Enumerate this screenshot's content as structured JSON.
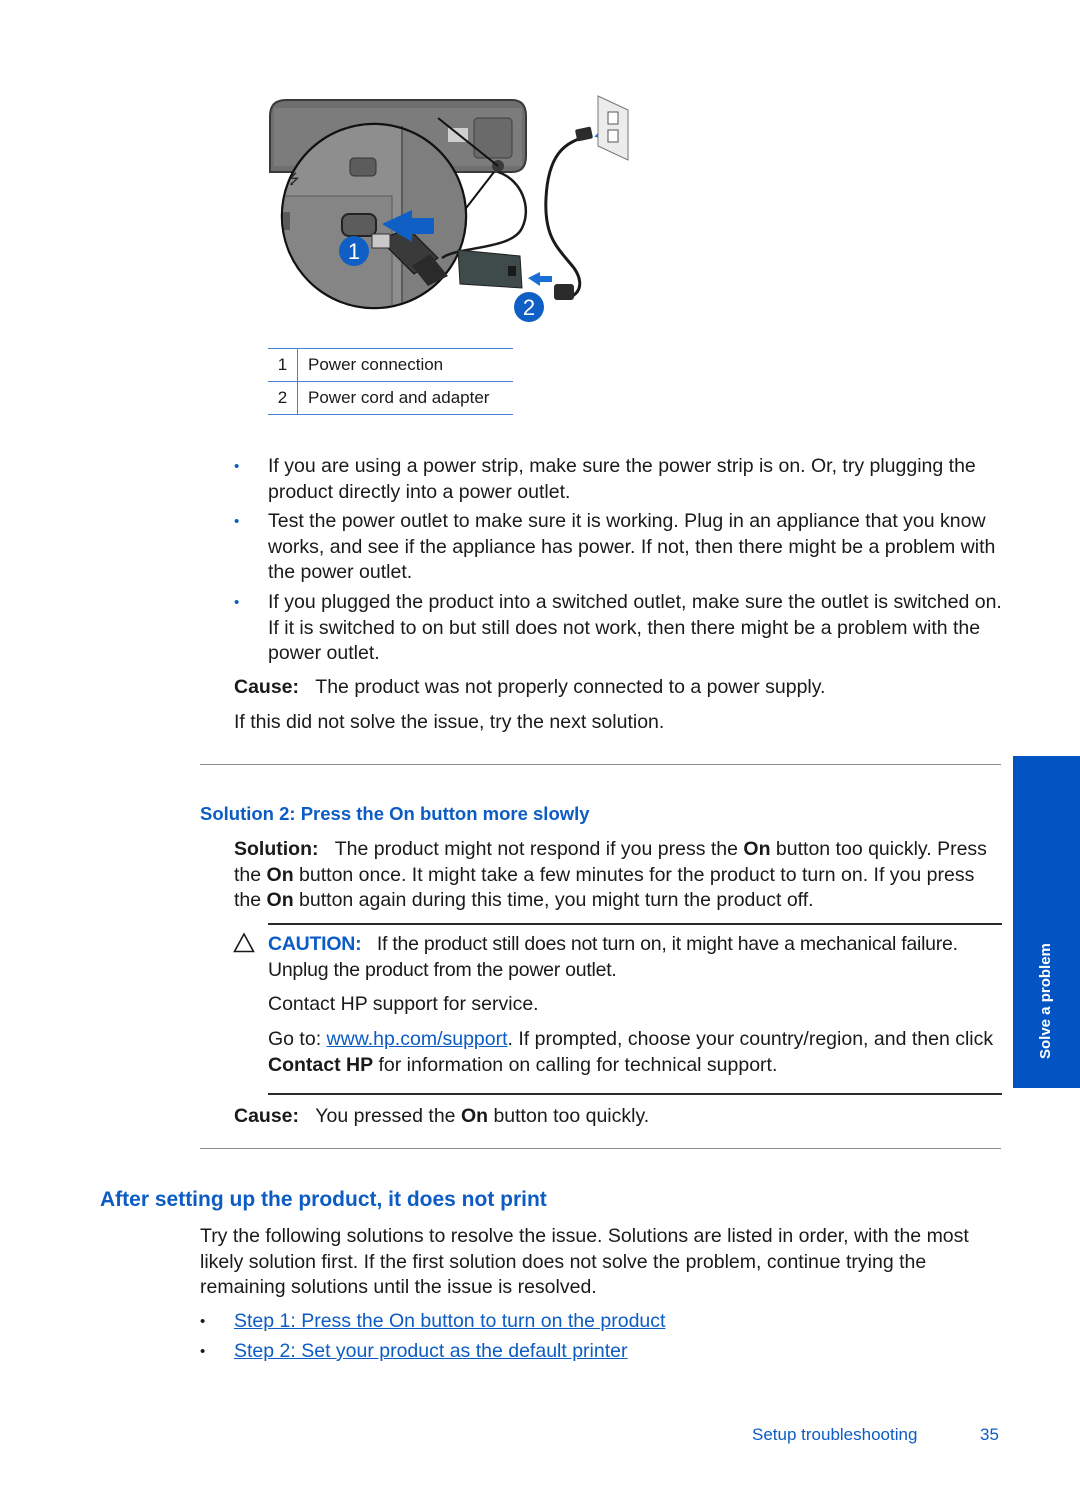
{
  "figure": {
    "callouts": [
      "1",
      "2"
    ],
    "legend": [
      {
        "num": "1",
        "label": "Power connection"
      },
      {
        "num": "2",
        "label": "Power cord and adapter"
      }
    ]
  },
  "solution1": {
    "bullets": [
      "If you are using a power strip, make sure the power strip is on. Or, try plugging the product directly into a power outlet.",
      "Test the power outlet to make sure it is working. Plug in an appliance that you know works, and see if the appliance has power. If not, then there might be a problem with the power outlet.",
      "If you plugged the product into a switched outlet, make sure the outlet is switched on. If it is switched to on but still does not work, then there might be a problem with the power outlet."
    ],
    "cause_label": "Cause:",
    "cause_text": "The product was not properly connected to a power supply.",
    "next_text": "If this did not solve the issue, try the next solution."
  },
  "solution2": {
    "heading": "Solution 2: Press the On button more slowly",
    "solution_label": "Solution:",
    "text_parts": [
      "The product might not respond if you press the ",
      "On",
      " button too quickly. Press the ",
      "On",
      " button once. It might take a few minutes for the product to turn on. If you press the ",
      "On",
      " button again during this time, you might turn the product off."
    ],
    "caution": {
      "label": "CAUTION:",
      "text": "If the product still does not turn on, it might have a mechanical failure. Unplug the product from the power outlet.",
      "contact": "Contact HP support for service.",
      "goto_prefix": "Go to: ",
      "goto_link": "www.hp.com/support",
      "goto_mid": ". If prompted, choose your country/region, and then click ",
      "goto_bold": "Contact HP",
      "goto_suffix": " for information on calling for technical support."
    },
    "cause_label": "Cause:",
    "cause_prefix": "You pressed the ",
    "cause_bold": "On",
    "cause_suffix": " button too quickly."
  },
  "section": {
    "heading": "After setting up the product, it does not print",
    "intro": "Try the following solutions to resolve the issue. Solutions are listed in order, with the most likely solution first. If the first solution does not solve the problem, continue trying the remaining solutions until the issue is resolved.",
    "links": [
      "Step 1: Press the On button to turn on the product",
      "Step 2: Set your product as the default printer"
    ]
  },
  "side_tab": {
    "label": "Solve a problem",
    "color": "#0154c2"
  },
  "footer": {
    "chapter": "Setup troubleshooting",
    "page": "35"
  },
  "colors": {
    "accent": "#0c5cc4"
  }
}
